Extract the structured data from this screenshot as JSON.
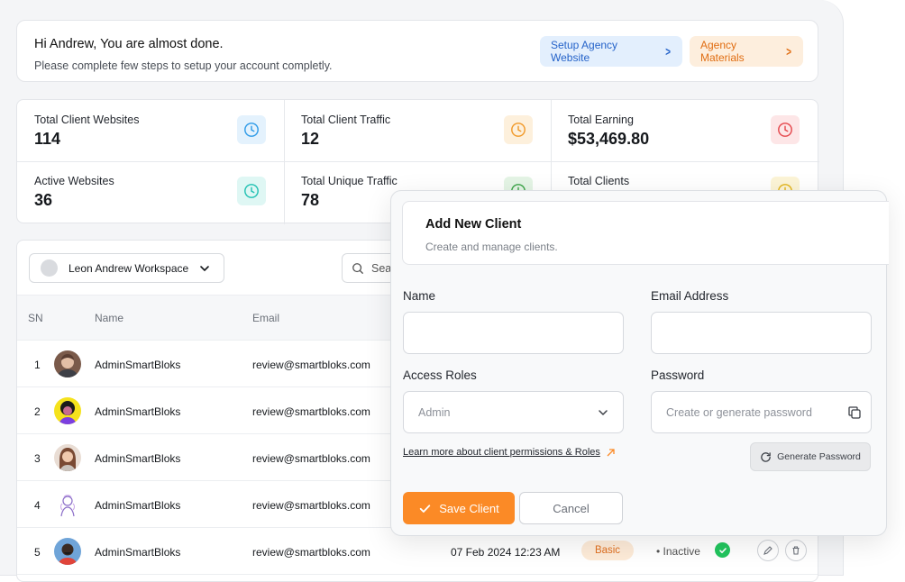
{
  "welcome": {
    "title": "Hi Andrew, You are almost done.",
    "subtitle": "Please complete few steps to setup your account completly.",
    "setup_button": "Setup Agency Website",
    "materials_button": "Agency Materials"
  },
  "stats": [
    {
      "label": "Total Client Websites",
      "value": "114",
      "icon": "clock-icon",
      "color": "#2f9be8"
    },
    {
      "label": "Total Client Traffic",
      "value": "12",
      "icon": "clock-icon",
      "color": "#f19a2a"
    },
    {
      "label": "Total Earning",
      "value": "$53,469.80",
      "icon": "clock-icon",
      "color": "#e5484d"
    },
    {
      "label": "Active Websites",
      "value": "36",
      "icon": "clock-icon",
      "color": "#22c1b3"
    },
    {
      "label": "Total Unique Traffic",
      "value": "78",
      "icon": "clock-icon",
      "color": "#3ea64a"
    },
    {
      "label": "Total Clients",
      "value": "",
      "icon": "clock-icon",
      "color": "#e3b51c"
    }
  ],
  "table": {
    "workspace": "Leon Andrew Workspace",
    "search_placeholder": "Sea",
    "headers": {
      "sn": "SN",
      "name": "Name",
      "email": "Email"
    },
    "rows": [
      {
        "sn": "1",
        "name": "AdminSmartBloks",
        "email": "review@smartbloks.com"
      },
      {
        "sn": "2",
        "name": "AdminSmartBloks",
        "email": "review@smartbloks.com"
      },
      {
        "sn": "3",
        "name": "AdminSmartBloks",
        "email": "review@smartbloks.com"
      },
      {
        "sn": "4",
        "name": "AdminSmartBloks",
        "email": "review@smartbloks.com"
      },
      {
        "sn": "5",
        "name": "AdminSmartBloks",
        "email": "review@smartbloks.com",
        "date": "07 Feb 2024 12:23 AM",
        "plan": "Basic",
        "status": "Inactive"
      }
    ]
  },
  "modal": {
    "title": "Add New Client",
    "subtitle": "Create and manage clients.",
    "name_label": "Name",
    "name_value": "",
    "email_label": "Email Address",
    "email_value": "",
    "roles_label": "Access Roles",
    "roles_value": "Admin",
    "password_label": "Password",
    "password_placeholder": "Create or generate password",
    "learn_link": "Learn more about client permissions & Roles",
    "generate_button": "Generate Password",
    "save_button": "Save Client",
    "cancel_button": "Cancel"
  },
  "colors": {
    "accent": "#fb8a26",
    "blue": "#2563c9",
    "success": "#22c55e"
  }
}
